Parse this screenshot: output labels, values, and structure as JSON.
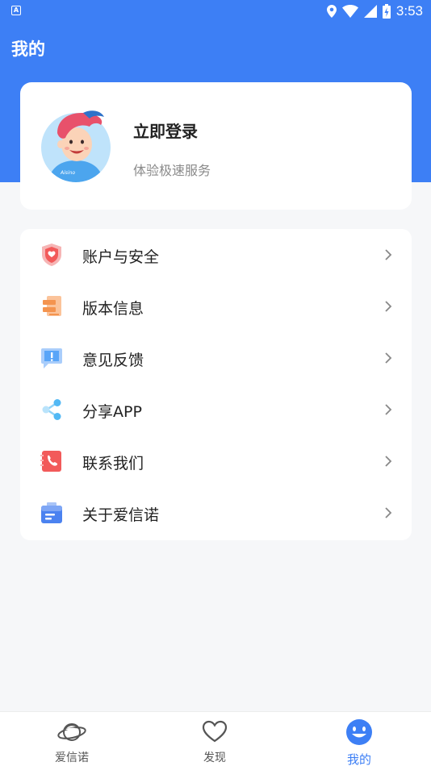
{
  "status_bar": {
    "app_badge": "A",
    "time": "3:53"
  },
  "header": {
    "title": "我的"
  },
  "profile": {
    "login_label": "立即登录",
    "subtitle": "体验极速服务",
    "avatar_text": "Aisino"
  },
  "menu": {
    "items": [
      {
        "label": "账户与安全",
        "icon": "shield-icon",
        "color": "#f25a5a"
      },
      {
        "label": "版本信息",
        "icon": "document-icon",
        "color": "#f4944f"
      },
      {
        "label": "意见反馈",
        "icon": "feedback-icon",
        "color": "#4b9df7"
      },
      {
        "label": "分享APP",
        "icon": "share-icon",
        "color": "#52b8f4"
      },
      {
        "label": "联系我们",
        "icon": "phone-icon",
        "color": "#f25a5a"
      },
      {
        "label": "关于爱信诺",
        "icon": "info-box-icon",
        "color": "#4b82f0"
      }
    ]
  },
  "tabbar": {
    "tabs": [
      {
        "label": "爱信诺",
        "icon": "planet-icon",
        "active": false
      },
      {
        "label": "发现",
        "icon": "heart-icon",
        "active": false
      },
      {
        "label": "我的",
        "icon": "smiley-icon",
        "active": true
      }
    ]
  },
  "colors": {
    "primary": "#3d7ff5",
    "background": "#f6f7f9"
  }
}
